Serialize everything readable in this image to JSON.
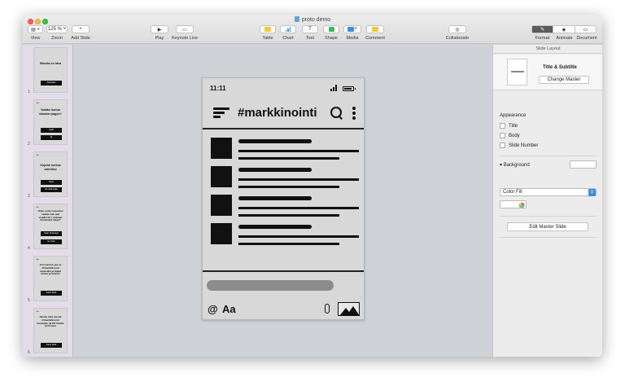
{
  "window": {
    "title": "proto demo"
  },
  "toolbar": {
    "view_label": "View",
    "zoom_label": "Zoom",
    "zoom_value": "125 %",
    "add_slide_label": "Add Slide",
    "play_label": "Play",
    "keynote_live_label": "Keynote Live",
    "table_label": "Table",
    "chart_label": "Chart",
    "text_label": "Text",
    "shape_label": "Shape",
    "media_label": "Media",
    "comment_label": "Comment",
    "collaborate_label": "Collaborate",
    "format_label": "Format",
    "animate_label": "Animate",
    "document_label": "Document"
  },
  "navigator": {
    "slides": [
      {
        "number": "1",
        "title": "Minulla on idea",
        "buttons": [
          "Aloitetaan"
        ]
      },
      {
        "number": "2",
        "title": "Saatko luotua ideasta ryagon?",
        "buttons": [
          "Kyllä",
          "Ei"
        ]
      },
      {
        "number": "3",
        "title": "Kirjoita runkoa valmiiksi",
        "buttons": [
          "Tehty",
          "En vielä osaa"
        ]
      },
      {
        "number": "4",
        "title": "Onko runko tarpeeksi selkeä että saat sisällöstä 1 rankaan tiivistettyä ideaa?",
        "buttons": [
          "Saan tiivistettyä",
          "En vielä"
        ]
      },
      {
        "number": "5",
        "title": "Jee! Hienoa, jaa se ##markkinointi kanavalla ja tägää tiimisi ja ihmiset",
        "buttons": [
          "Katso tästä"
        ]
      },
      {
        "number": "6",
        "title": "Siistiä, laita viestiä ##markkinointi kanavalle tai PR tiimille ja ihmiset",
        "buttons": [
          "Katso tästä"
        ]
      }
    ]
  },
  "phone": {
    "time": "11:11",
    "channel": "#markkinointi",
    "at_symbol": "@",
    "text_format": "Aa"
  },
  "inspector": {
    "header": "Slide Layout",
    "layout_name": "Title & Subtitle",
    "change_master": "Change Master",
    "appearance_title": "Appearance",
    "options": [
      "Title",
      "Body",
      "Slide Number"
    ],
    "background_title": "Background",
    "fill_value": "Color Fill",
    "edit_master": "Edit Master Slide"
  }
}
